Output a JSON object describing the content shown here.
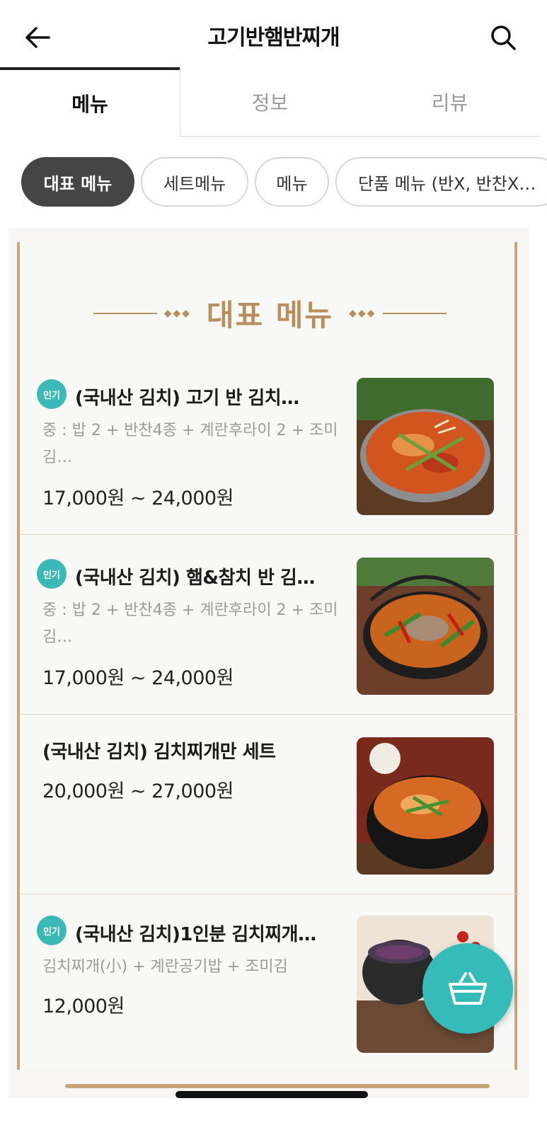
{
  "header": {
    "title": "고기반햄반찌개",
    "back_icon": "arrow-left-icon",
    "search_icon": "search-icon"
  },
  "tabs": [
    {
      "label": "메뉴",
      "active": true
    },
    {
      "label": "정보",
      "active": false
    },
    {
      "label": "리뷰",
      "active": false
    }
  ],
  "categories": [
    {
      "label": "대표 메뉴",
      "active": true
    },
    {
      "label": "세트메뉴",
      "active": false
    },
    {
      "label": "메뉴",
      "active": false
    },
    {
      "label": "단품 메뉴 (반X, 반찬X…",
      "active": false
    }
  ],
  "section": {
    "title": "대표 메뉴"
  },
  "items": [
    {
      "badge": "인기",
      "name": "(국내산 김치) 고기 반 김치…",
      "desc": "중 : 밥 2 + 반찬4종 + 계란후라이 2 + 조미김…",
      "price": "17,000원 ~ 24,000원"
    },
    {
      "badge": "인기",
      "name": "(국내산 김치) 햄&참치 반 김…",
      "desc": "중 : 밥 2 + 반찬4종 + 계란후라이 2 + 조미김…",
      "price": "17,000원 ~ 24,000원"
    },
    {
      "badge": "",
      "name": "(국내산 김치) 김치찌개만 세트",
      "desc": "",
      "price": "20,000원 ~ 27,000원"
    },
    {
      "badge": "인기",
      "name": "(국내산 김치)1인분 김치찌개…",
      "desc": "김치찌개(小) + 계란공기밥 + 조미김",
      "price": "12,000원"
    }
  ],
  "colors": {
    "accent": "#36bcb8",
    "gold": "#b8905f",
    "chip_active": "#454545"
  },
  "cart_icon": "basket-icon"
}
